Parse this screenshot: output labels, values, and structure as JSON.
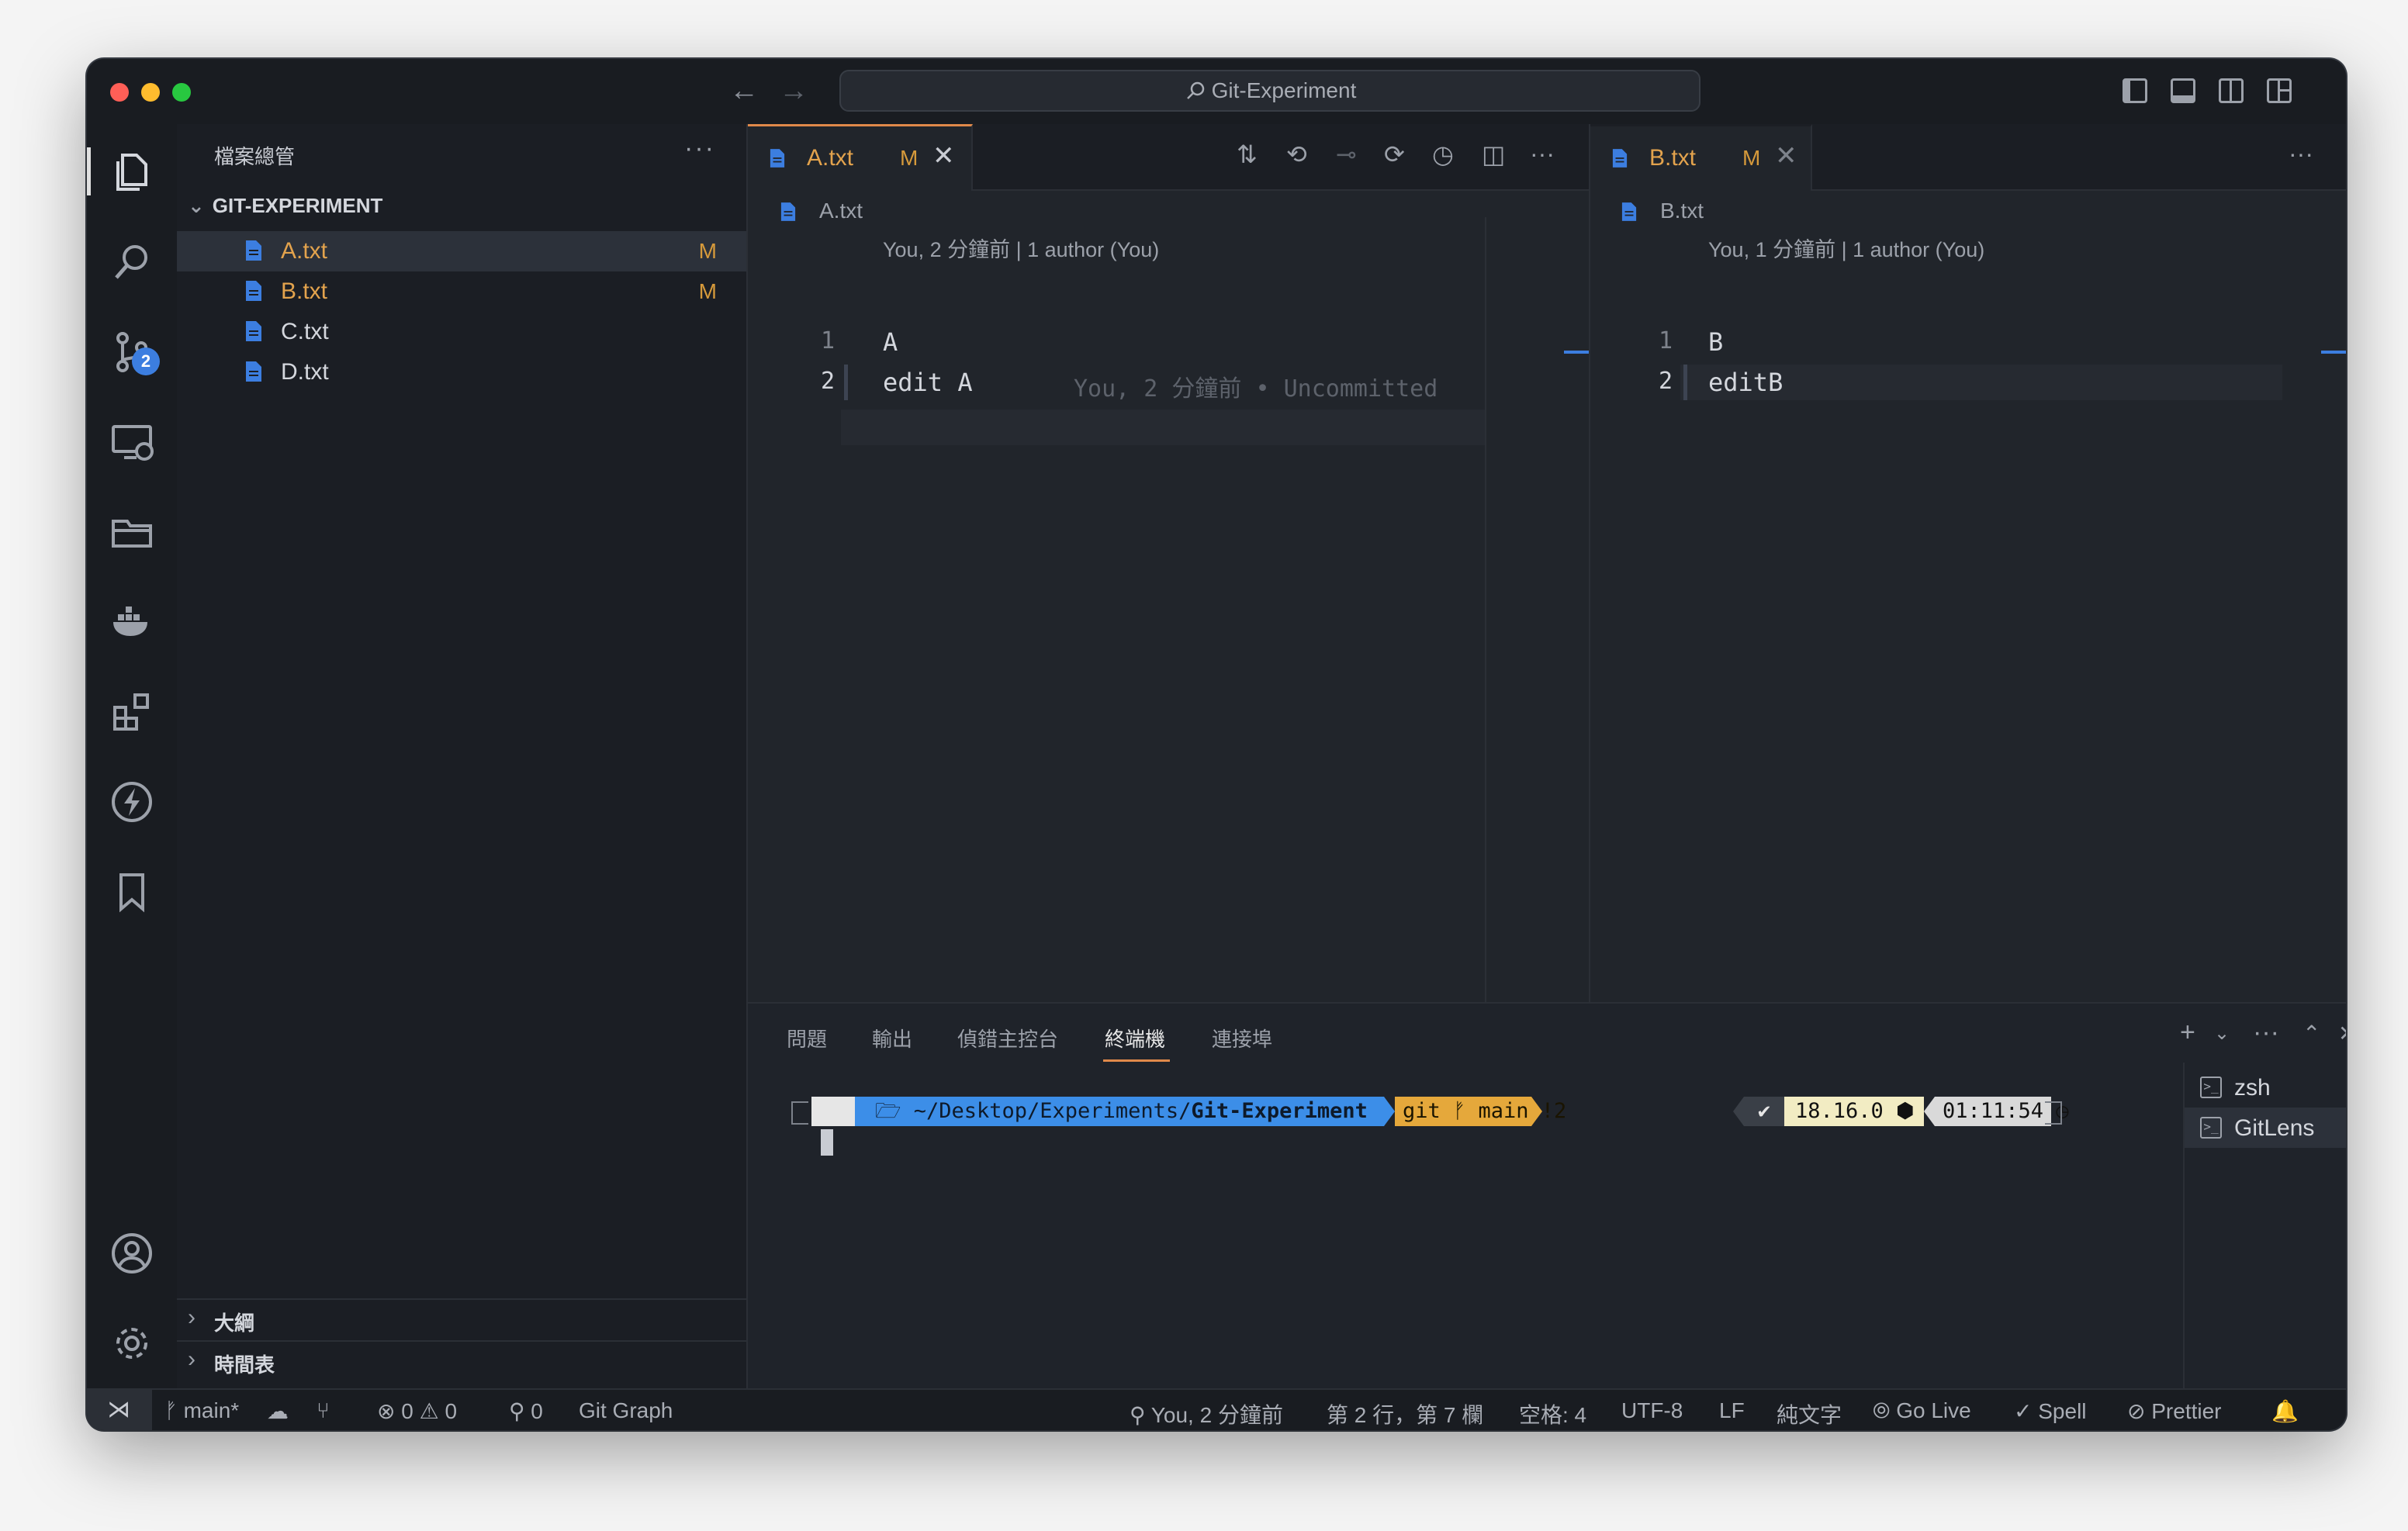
{
  "window": {
    "search_title": "Git-Experiment"
  },
  "activity_bar": {
    "icons": [
      "explorer-icon",
      "search-icon",
      "source-control-icon",
      "remote-explorer-icon",
      "folder-icon",
      "docker-icon",
      "extensions-icon",
      "thunder-icon",
      "bookmark-icon",
      "account-icon",
      "settings-gear-icon"
    ],
    "source_control_badge": "2"
  },
  "sidebar": {
    "title": "檔案總管",
    "more": "···",
    "folder": "GIT-EXPERIMENT",
    "files": [
      {
        "name": "A.txt",
        "status": "M",
        "modified": true,
        "selected": true
      },
      {
        "name": "B.txt",
        "status": "M",
        "modified": true,
        "selected": false
      },
      {
        "name": "C.txt",
        "status": "",
        "modified": false,
        "selected": false
      },
      {
        "name": "D.txt",
        "status": "",
        "modified": false,
        "selected": false
      }
    ],
    "sections": [
      "大綱",
      "時間表"
    ]
  },
  "editor_left": {
    "tab_name": "A.txt",
    "tab_status": "M",
    "breadcrumb": "A.txt",
    "codelens": "You, 2 分鐘前 | 1 author (You)",
    "lines": [
      {
        "number": "1",
        "text": "A"
      },
      {
        "number": "2",
        "text": "edit A"
      }
    ],
    "blame": "You, 2 分鐘前 • Uncommitted"
  },
  "editor_right": {
    "tab_name": "B.txt",
    "tab_status": "M",
    "breadcrumb": "B.txt",
    "codelens": "You, 1 分鐘前 | 1 author (You)",
    "lines": [
      {
        "number": "1",
        "text": "B"
      },
      {
        "number": "2",
        "text": "editB"
      }
    ]
  },
  "panel": {
    "tabs": [
      "問題",
      "輸出",
      "偵錯主控台",
      "終端機",
      "連接埠"
    ],
    "active_tab": "終端機",
    "terminals": [
      {
        "name": "zsh",
        "selected": false
      },
      {
        "name": "GitLens",
        "selected": true
      }
    ],
    "prompt": {
      "apple": "",
      "path_prefix": "🗁 ~/Desktop/Experiments/",
      "path_dir": "Git-Experiment",
      "git": "git ᚠ main !2",
      "check": "✔",
      "node": "18.16.0 ⬢",
      "time": "01:11:54 ◷"
    }
  },
  "status_bar": {
    "branch": "main*",
    "errors": "0",
    "warnings": "0",
    "ports": "0",
    "git_graph": "Git Graph",
    "blame": "You, 2 分鐘前",
    "position": "第 2 行，第 7 欄",
    "spaces": "空格: 4",
    "encoding": "UTF-8",
    "eol": "LF",
    "language": "純文字",
    "go_live": "Go Live",
    "spell": "Spell",
    "prettier": "Prettier"
  },
  "colors": {
    "modified": "#e3a34d",
    "accent": "#3c7ee0",
    "tab_border": "#e0894a"
  }
}
